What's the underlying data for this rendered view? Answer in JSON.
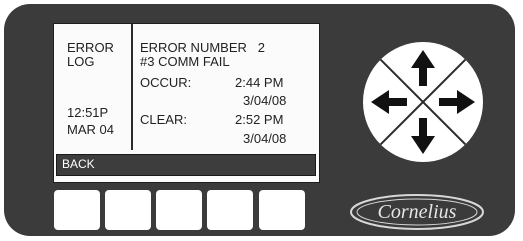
{
  "screen": {
    "left_panel": {
      "title_line1": "ERROR",
      "title_line2": "LOG",
      "time": "12:51P",
      "date": "MAR 04"
    },
    "error": {
      "header": "ERROR NUMBER   2",
      "code_desc": "#3 COMM FAIL",
      "occur_label": "OCCUR:",
      "occur_time": "2:44 PM",
      "occur_date": "3/04/08",
      "clear_label": "CLEAR:",
      "clear_time": "2:52 PM",
      "clear_date": "3/04/08"
    },
    "back_label": "BACK"
  },
  "softkeys": [
    "",
    "",
    "",
    "",
    ""
  ],
  "nav_pad": {
    "up_icon": "arrow-up-icon",
    "down_icon": "arrow-down-icon",
    "left_icon": "arrow-left-icon",
    "right_icon": "arrow-right-icon"
  },
  "brand": {
    "logo_text": "Cornelius"
  },
  "colors": {
    "bezel": "#3b3b3b",
    "screen": "#fbfbfb",
    "back_bar": "#3d3d3d",
    "keys": "#ffffff"
  }
}
